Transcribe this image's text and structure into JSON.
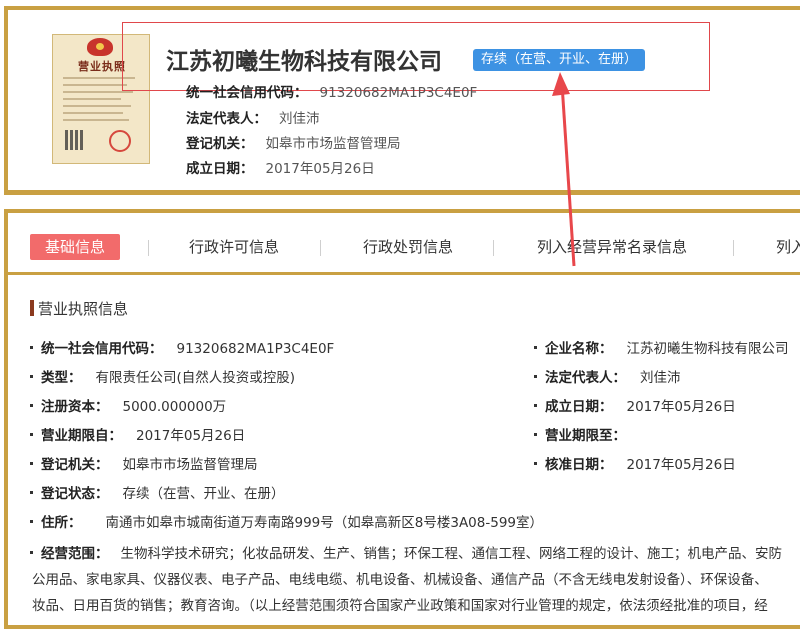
{
  "header": {
    "license_image": {
      "title": "营业执照",
      "icon": "business-license-image"
    },
    "company_name": "江苏初曦生物科技有限公司",
    "status_badge": "存续（在营、开业、在册）",
    "rows": [
      {
        "label": "统一社会信用代码：",
        "value": "91320682MA1P3C4E0F"
      },
      {
        "label": "法定代表人：",
        "value": "刘佳沛"
      },
      {
        "label": "登记机关：",
        "value": "如皋市市场监督管理局"
      },
      {
        "label": "成立日期：",
        "value": "2017年05月26日"
      }
    ]
  },
  "tabs": [
    {
      "label": "基础信息",
      "active": true
    },
    {
      "label": "行政许可信息",
      "active": false
    },
    {
      "label": "行政处罚信息",
      "active": false
    },
    {
      "label": "列入经营异常名录信息",
      "active": false
    },
    {
      "label": "列入",
      "active": false
    }
  ],
  "section": {
    "title": "营业执照信息"
  },
  "fields_left": [
    {
      "label": "统一社会信用代码：",
      "value": "91320682MA1P3C4E0F"
    },
    {
      "label": "类型：",
      "value": "有限责任公司(自然人投资或控股)"
    },
    {
      "label": "注册资本：",
      "value": "5000.000000万"
    },
    {
      "label": "营业期限自：",
      "value": "2017年05月26日"
    },
    {
      "label": "登记机关：",
      "value": "如皋市市场监督管理局"
    },
    {
      "label": "登记状态：",
      "value": "存续（在营、开业、在册）"
    },
    {
      "label": "住所：",
      "value": "南通市如皋市城南街道万寿南路999号（如皋高新区8号楼3A08-599室）"
    }
  ],
  "fields_right": [
    {
      "label": "企业名称：",
      "value": "江苏初曦生物科技有限公司"
    },
    {
      "label": "法定代表人：",
      "value": "刘佳沛"
    },
    {
      "label": "成立日期：",
      "value": "2017年05月26日"
    },
    {
      "label": "营业期限至：",
      "value": ""
    },
    {
      "label": "核准日期：",
      "value": "2017年05月26日"
    }
  ],
  "business_scope": {
    "label": "经营范围：",
    "line1": "生物科学技术研究；化妆品研发、生产、销售；环保工程、通信工程、网络工程的设计、施工；机电产品、安防",
    "line2": "公用品、家电家具、仪器仪表、电子产品、电线电缆、机电设备、机械设备、通信产品（不含无线电发射设备）、环保设备、",
    "line3": "妆品、日用百货的销售；教育咨询。（以上经营范围须符合国家产业政策和国家对行业管理的规定，依法须经批准的项目，经"
  },
  "colors": {
    "gold_border": "#c9a042",
    "status_blue": "#3d92e3",
    "active_tab": "#f26b6b",
    "highlight_red": "#e0474b"
  }
}
